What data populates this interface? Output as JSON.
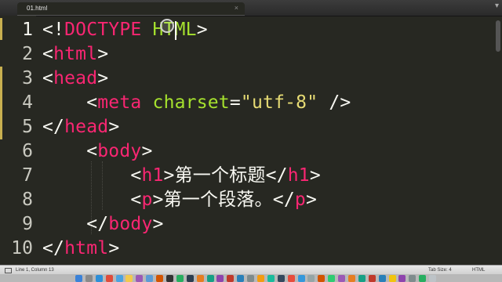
{
  "tab": {
    "label": "01.html",
    "close": "×",
    "dropdown": "▾"
  },
  "lines": [
    {
      "n": "1",
      "tokens": [
        {
          "c": "t-punct",
          "t": "<!"
        },
        {
          "c": "t-tag",
          "t": "DOCTYPE"
        },
        {
          "c": "t-punct",
          "t": " "
        },
        {
          "c": "t-attr",
          "t": "HTML"
        },
        {
          "c": "t-punct",
          "t": ">"
        }
      ]
    },
    {
      "n": "2",
      "tokens": [
        {
          "c": "t-punct",
          "t": "<"
        },
        {
          "c": "t-tag",
          "t": "html"
        },
        {
          "c": "t-punct",
          "t": ">"
        }
      ]
    },
    {
      "n": "3",
      "tokens": [
        {
          "c": "t-punct",
          "t": "<"
        },
        {
          "c": "t-tag",
          "t": "head"
        },
        {
          "c": "t-punct",
          "t": ">"
        }
      ]
    },
    {
      "n": "4",
      "tokens": [
        {
          "c": "t-punct",
          "t": "    <"
        },
        {
          "c": "t-tag",
          "t": "meta"
        },
        {
          "c": "t-punct",
          "t": " "
        },
        {
          "c": "t-attr",
          "t": "charset"
        },
        {
          "c": "t-punct",
          "t": "="
        },
        {
          "c": "t-str",
          "t": "\"utf-8\""
        },
        {
          "c": "t-punct",
          "t": " />"
        }
      ]
    },
    {
      "n": "5",
      "tokens": [
        {
          "c": "t-punct",
          "t": "</"
        },
        {
          "c": "t-tag",
          "t": "head"
        },
        {
          "c": "t-punct",
          "t": ">"
        }
      ]
    },
    {
      "n": "6",
      "tokens": [
        {
          "c": "t-punct",
          "t": "    <"
        },
        {
          "c": "t-tag",
          "t": "body"
        },
        {
          "c": "t-punct",
          "t": ">"
        }
      ]
    },
    {
      "n": "7",
      "tokens": [
        {
          "c": "t-punct",
          "t": "        <"
        },
        {
          "c": "t-tag",
          "t": "h1"
        },
        {
          "c": "t-punct",
          "t": ">"
        },
        {
          "c": "t-text",
          "t": "第一个标题"
        },
        {
          "c": "t-punct",
          "t": "</"
        },
        {
          "c": "t-tag",
          "t": "h1"
        },
        {
          "c": "t-punct",
          "t": ">"
        }
      ]
    },
    {
      "n": "8",
      "tokens": [
        {
          "c": "t-punct",
          "t": "        <"
        },
        {
          "c": "t-tag",
          "t": "p"
        },
        {
          "c": "t-punct",
          "t": ">"
        },
        {
          "c": "t-text",
          "t": "第一个段落。"
        },
        {
          "c": "t-punct",
          "t": "</"
        },
        {
          "c": "t-tag",
          "t": "p"
        },
        {
          "c": "t-punct",
          "t": ">"
        }
      ]
    },
    {
      "n": "9",
      "tokens": [
        {
          "c": "t-punct",
          "t": "    </"
        },
        {
          "c": "t-tag",
          "t": "body"
        },
        {
          "c": "t-punct",
          "t": ">"
        }
      ]
    },
    {
      "n": "10",
      "tokens": [
        {
          "c": "t-punct",
          "t": "</"
        },
        {
          "c": "t-tag",
          "t": "html"
        },
        {
          "c": "t-punct",
          "t": ">"
        }
      ]
    }
  ],
  "current_line": "1",
  "status": {
    "position": "Line 1, Column 13",
    "tab_size": "Tab Size: 4",
    "syntax": "HTML"
  },
  "colors": {
    "background": "#272822",
    "tag": "#f92672",
    "attribute": "#a6e22e",
    "string": "#e6db74",
    "text": "#f8f8f2"
  },
  "dock": {
    "icons": [
      "finder-icon",
      "launchpad-icon",
      "safari-icon",
      "chrome-icon",
      "mail-icon",
      "notes-icon",
      "app-icon",
      "app-icon",
      "app-icon",
      "terminal-icon",
      "app-icon",
      "app-icon",
      "app-icon",
      "app-icon",
      "app-icon",
      "app-icon",
      "app-icon",
      "app-icon",
      "app-icon",
      "app-icon",
      "app-icon",
      "app-icon",
      "app-icon",
      "app-icon",
      "app-icon",
      "app-icon",
      "app-icon",
      "app-icon",
      "app-icon",
      "app-icon",
      "app-icon",
      "app-icon",
      "app-icon",
      "app-icon",
      "app-icon",
      "trash-icon"
    ],
    "colors": [
      "#3b82d8",
      "#8a8a8a",
      "#2d8fd8",
      "#e04b3b",
      "#4aa3e0",
      "#f2c94c",
      "#9b59b6",
      "#5b9bd5",
      "#d35400",
      "#333333",
      "#27ae60",
      "#2c3e50",
      "#e67e22",
      "#16a085",
      "#8e44ad",
      "#c0392b",
      "#2980b9",
      "#7f8c8d",
      "#f39c12",
      "#1abc9c",
      "#34495e",
      "#e74c3c",
      "#3498db",
      "#95a5a6",
      "#d35400",
      "#2ecc71",
      "#9b59b6",
      "#e67e22",
      "#16a085",
      "#c0392b",
      "#2980b9",
      "#f1c40f",
      "#8e44ad",
      "#7f8c8d",
      "#27ae60",
      "#bdc3c7"
    ]
  }
}
